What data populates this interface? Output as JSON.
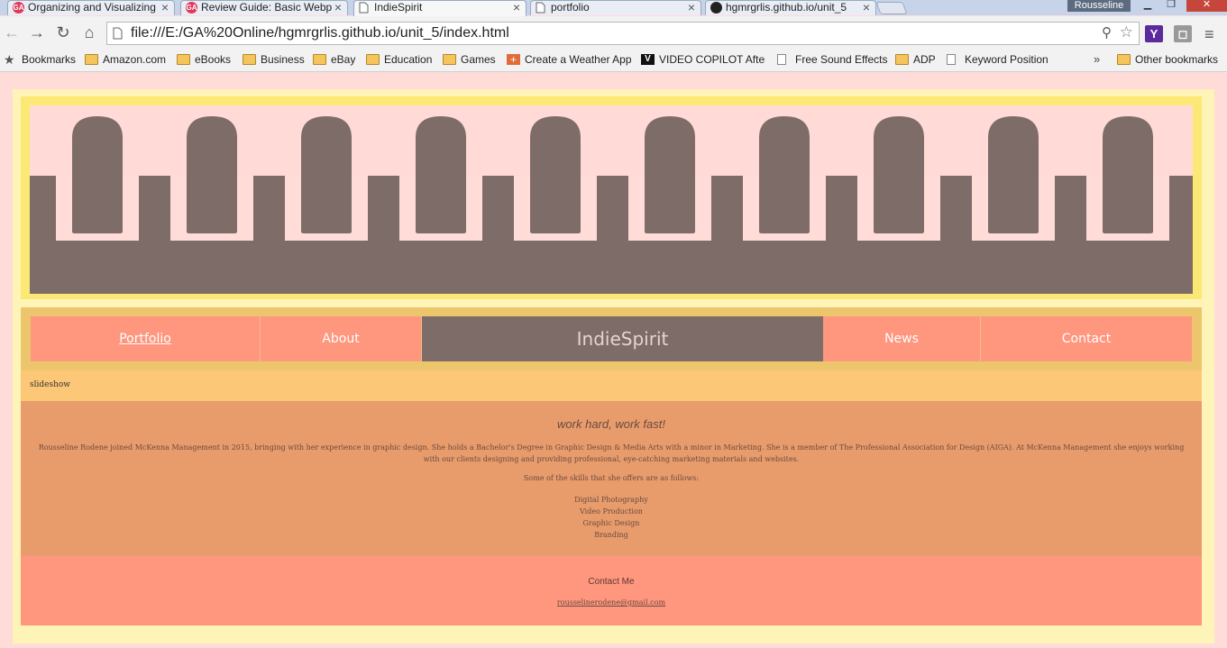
{
  "browser": {
    "tabs": [
      {
        "title": "Organizing and Visualizing",
        "icon": "ga-icon"
      },
      {
        "title": "Review Guide: Basic Webp",
        "icon": "ga-icon"
      },
      {
        "title": "IndieSpirit",
        "icon": "document-icon"
      },
      {
        "title": "portfolio",
        "icon": "document-icon"
      },
      {
        "title": "hgmrgrlis.github.io/unit_5",
        "icon": "github-icon"
      }
    ],
    "profile_name": "Rousseline",
    "url": "file:///E:/GA%20Online/hgmrgrlis.github.io/unit_5/index.html",
    "bookmarks": [
      {
        "label": "Bookmarks",
        "icon": "star-icon"
      },
      {
        "label": "Amazon.com",
        "icon": "folder-icon"
      },
      {
        "label": "eBooks",
        "icon": "folder-icon"
      },
      {
        "label": "Business",
        "icon": "folder-icon"
      },
      {
        "label": "eBay",
        "icon": "folder-icon"
      },
      {
        "label": "Education",
        "icon": "folder-icon"
      },
      {
        "label": "Games",
        "icon": "folder-icon"
      },
      {
        "label": "Create a Weather App",
        "icon": "plus-icon"
      },
      {
        "label": "VIDEO COPILOT  After",
        "icon": "vc-icon"
      },
      {
        "label": "Free Sound Effects",
        "icon": "page-icon"
      },
      {
        "label": "ADP",
        "icon": "folder-icon"
      },
      {
        "label": "Keyword Position",
        "icon": "page-icon"
      }
    ],
    "other_bookmarks": "Other bookmarks",
    "overflow": "»"
  },
  "site": {
    "nav": {
      "portfolio": "Portfolio",
      "about": "About",
      "brand": "IndieSpirit",
      "news": "News",
      "contact": "Contact"
    },
    "slideshow_label": "slideshow",
    "about": {
      "tagline": "work hard, work fast!",
      "bio": "Rousseline Rodene joined McKenna Management in 2015, bringing with her experience in graphic design. She holds a Bachelor's Degree in Graphic Design & Media Arts with a minor in Marketing. She is a member of The Professional Association for Design (AIGA). At McKenna Management she enjoys working with our clients designing and providing professional, eye-catching marketing materials and websites.",
      "skills_intro": "Some of the skills that she offers are as follows:",
      "skills": [
        "Digital Photography",
        "Video Production",
        "Graphic Design",
        "Branding"
      ]
    },
    "contact": {
      "title": "Contact Me",
      "email": "rousselinerodene@gmail.com"
    }
  },
  "colors": {
    "page_bg": "#ffdcd8",
    "banner_frame": "#fbe875",
    "banner_shape": "#7e6c69",
    "nav_bg": "#ff967e",
    "nav_wrap": "#ecc56c",
    "slideshow_bg": "#fdc778",
    "about_bg": "#e89c6c",
    "contact_bg": "#ff967e"
  }
}
